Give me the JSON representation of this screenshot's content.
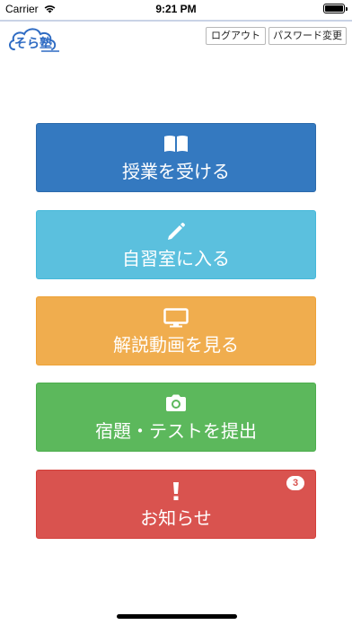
{
  "status_bar": {
    "carrier": "Carrier",
    "time": "9:21 PM",
    "battery_level": 1.0
  },
  "header": {
    "logo_text": "そら塾",
    "logout_label": "ログアウト",
    "password_change_label": "パスワード変更"
  },
  "menu": {
    "lesson": {
      "label": "授業を受ける",
      "icon": "book-icon",
      "color": "#3479c0"
    },
    "self_study": {
      "label": "自習室に入る",
      "icon": "pencil-icon",
      "color": "#5bc0de"
    },
    "video": {
      "label": "解説動画を見る",
      "icon": "monitor-icon",
      "color": "#f0ad4e"
    },
    "submit": {
      "label": "宿題・テストを提出",
      "icon": "camera-icon",
      "color": "#5cb85c"
    },
    "notice": {
      "label": "お知らせ",
      "icon": "exclamation-icon",
      "color": "#d9534f",
      "badge_count": "3"
    }
  }
}
